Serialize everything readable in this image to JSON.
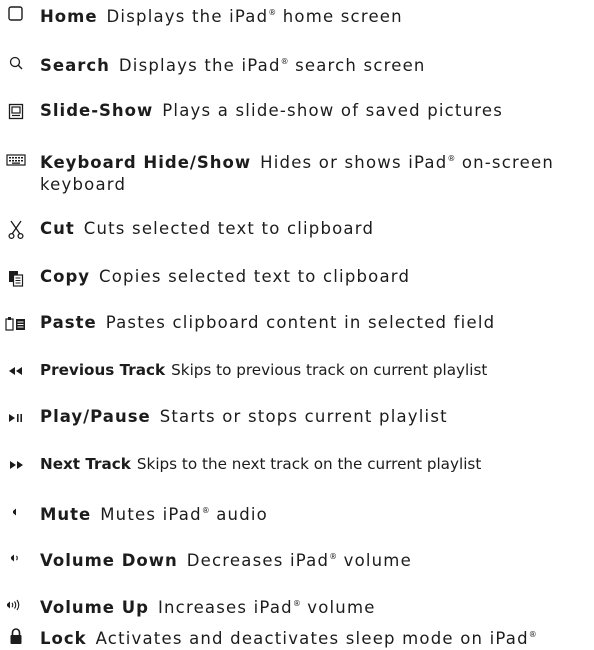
{
  "commands": [
    {
      "icon": "home-icon",
      "name": "Home",
      "desc": "Displays the iPad® home screen"
    },
    {
      "icon": "search-icon",
      "name": "Search",
      "desc": "Displays the iPad® search screen"
    },
    {
      "icon": "slideshow-icon",
      "name": "Slide-Show",
      "desc": "Plays a slide-show of saved pictures"
    },
    {
      "icon": "keyboard-icon",
      "name": "Keyboard Hide/Show",
      "desc": "Hides or shows iPad® on-screen keyboard"
    },
    {
      "icon": "scissors-icon",
      "name": "Cut",
      "desc": "Cuts selected text to clipboard"
    },
    {
      "icon": "copy-icon",
      "name": "Copy",
      "desc": "Copies selected text to clipboard"
    },
    {
      "icon": "paste-icon",
      "name": "Paste",
      "desc": "Pastes clipboard content in selected field"
    },
    {
      "icon": "rewind-icon",
      "name": "Previous Track",
      "desc": "Skips to previous track on current playlist"
    },
    {
      "icon": "play-pause-icon",
      "name": "Play/Pause",
      "desc": "Starts or stops current playlist"
    },
    {
      "icon": "fast-forward-icon",
      "name": "Next Track",
      "desc": "Skips to the next track on the current playlist"
    },
    {
      "icon": "mute-icon",
      "name": "Mute",
      "desc": "Mutes iPad® audio"
    },
    {
      "icon": "volume-down-icon",
      "name": "Volume Down",
      "desc": "Decreases iPad® volume"
    },
    {
      "icon": "volume-up-icon",
      "name": "Volume Up",
      "desc": "Increases iPad® volume"
    },
    {
      "icon": "lock-icon",
      "name": "Lock",
      "desc": "Activates and deactivates sleep mode on iPad®"
    }
  ]
}
